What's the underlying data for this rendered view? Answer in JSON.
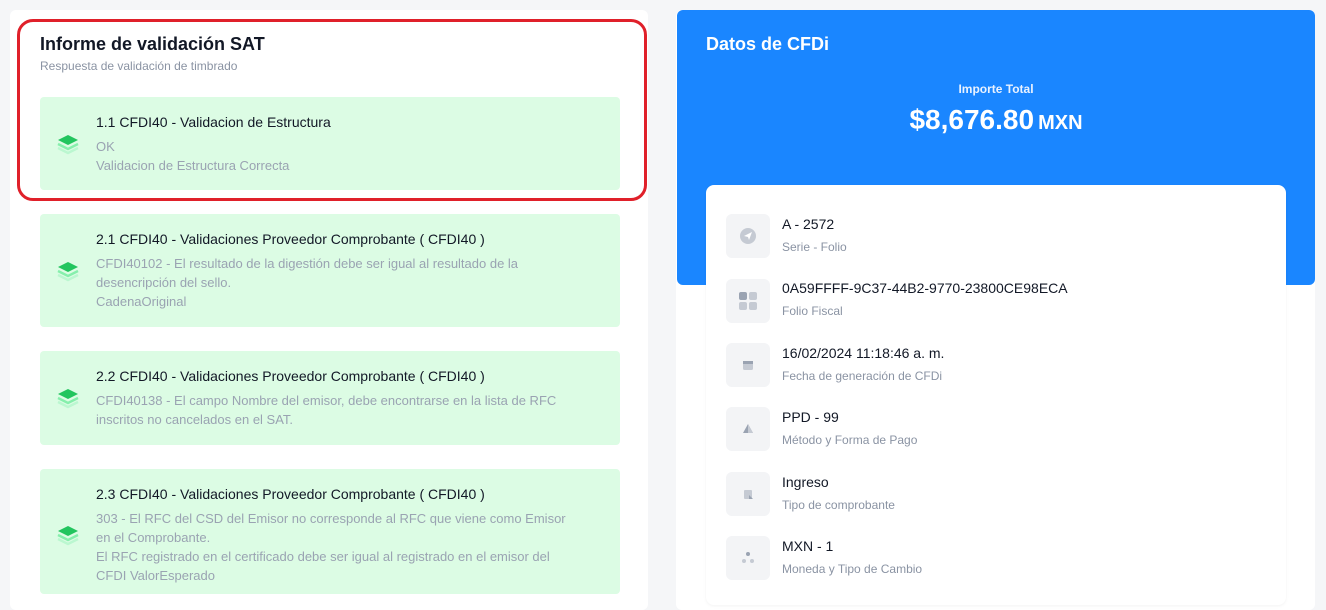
{
  "report": {
    "title": "Informe de validación SAT",
    "subtitle": "Respuesta de validación de timbrado",
    "items": [
      {
        "title": "1.1 CFDI40 - Validacion de Estructura",
        "lines": [
          "OK",
          "Validacion de Estructura Correcta"
        ]
      },
      {
        "title": "2.1 CFDI40 - Validaciones Proveedor Comprobante ( CFDI40 )",
        "lines": [
          "CFDI40102 - El resultado de la digestión debe ser igual al resultado de la",
          "desencripción del sello.",
          "CadenaOriginal"
        ]
      },
      {
        "title": "2.2 CFDI40 - Validaciones Proveedor Comprobante ( CFDI40 )",
        "lines": [
          "CFDI40138 - El campo Nombre del emisor, debe encontrarse en la lista de RFC",
          "inscritos no cancelados en el SAT."
        ]
      },
      {
        "title": "2.3 CFDI40 - Validaciones Proveedor Comprobante ( CFDI40 )",
        "lines": [
          "303 - El RFC del CSD del Emisor no corresponde al RFC que viene como Emisor",
          "en el Comprobante.",
          "El RFC registrado en el certificado debe ser igual al registrado en el emisor del",
          "CFDI ValorEsperado"
        ]
      }
    ]
  },
  "cfdi": {
    "title": "Datos de CFDi",
    "importe_label": "Importe Total",
    "importe_amount": "$8,676.80",
    "importe_currency": "MXN",
    "details": [
      {
        "value": "A - 2572",
        "label": "Serie - Folio",
        "icon": "send-icon"
      },
      {
        "value": "0A59FFFF-9C37-44B2-9770-23800CE98ECA",
        "label": "Folio Fiscal",
        "icon": "grid-icon"
      },
      {
        "value": "16/02/2024 11:18:46 a. m.",
        "label": "Fecha de generación de CFDi",
        "icon": "calendar-icon"
      },
      {
        "value": "PPD - 99",
        "label": "Método y Forma de Pago",
        "icon": "triangle-icon"
      },
      {
        "value": "Ingreso",
        "label": "Tipo de comprobante",
        "icon": "document-icon"
      },
      {
        "value": "MXN - 1",
        "label": "Moneda y Tipo de Cambio",
        "icon": "nodes-icon"
      }
    ]
  },
  "colors": {
    "accent_blue": "#1a86ff",
    "success_bg": "#dcfce4",
    "success_icon": "#22c55e",
    "highlight_red": "#e0202a"
  }
}
